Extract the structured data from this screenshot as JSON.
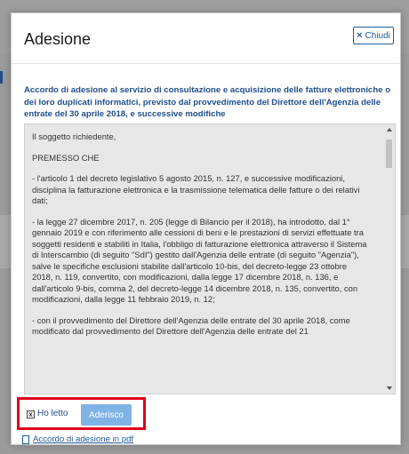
{
  "modal": {
    "title": "Adesione",
    "close_label": "Chiudi",
    "heading": "Accordo di adesione al servizio di consultazione e acquisizione delle fatture elettroniche o dei loro duplicati informatici, previsto dal provvedimento del Direttore dell'Agenzia delle entrate del 30 aprile 2018, e successive modifiche",
    "paragraphs": [
      "Il soggetto richiedente,",
      "PREMESSO CHE",
      "- l'articolo 1 del decreto legislativo 5 agosto 2015, n. 127, e successive modificazioni, disciplina la fatturazione elettronica e la trasmissione telematica delle fatture o dei relativi dati;",
      "- la legge 27 dicembre 2017, n. 205 (legge di Bilancio per il 2018), ha introdotto, dal 1° gennaio 2019 e con riferimento alle cessioni di beni e le prestazioni di servizi effettuate tra soggetti residenti e stabiliti in Italia, l'obbligo di fatturazione elettronica attraverso il Sistema di Interscambio (di seguito \"SdI\") gestito dall'Agenzia delle entrate (di seguito \"Agenzia\"), salve le specifiche esclusioni stabilite dall'articolo 10-bis, del decreto-legge 23 ottobre 2018, n. 119, convertito, con modificazioni, dalla legge 17 dicembre 2018, n. 136, e dall'articolo 9-bis, comma 2, del decreto-legge 14 dicembre 2018, n. 135, convertito, con modificazioni, dalla legge 11 febbraio 2019, n. 12;",
      "- con il provvedimento del Direttore dell'Agenzia delle entrate del 30 aprile 2018, come modificato dal provvedimento del Direttore dell'Agenzia delle entrate del 21"
    ],
    "checkbox_label": "Ho letto",
    "checkbox_checked": true,
    "accept_button": "Aderisco",
    "pdf_link": "Accordo di adesione in pdf"
  },
  "colors": {
    "heading": "#1f4e8c",
    "highlight_border": "#e0001b",
    "accept_button_bg": "#7fb2e5"
  }
}
